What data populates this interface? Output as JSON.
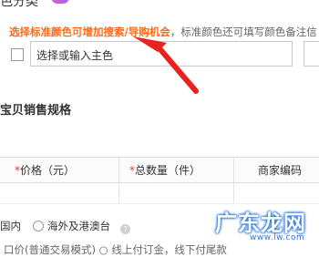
{
  "heading": {
    "partial_title": "色分类"
  },
  "hint": {
    "highlight": "选择标准颜色可增加搜索/导购机会",
    "rest": "，标准颜色还可填写颜色备注信"
  },
  "color_field": {
    "placeholder": "选择或输入主色"
  },
  "spec_section": {
    "title": "宝贝销售规格"
  },
  "table": {
    "columns": [
      {
        "required": "*",
        "label": "价格（元）"
      },
      {
        "required": "*",
        "label": "总数量（件）"
      },
      {
        "required": "",
        "label": "商家编码"
      }
    ]
  },
  "origin": {
    "option_domestic": "国内",
    "option_overseas": "海外及港澳台",
    "help": "?"
  },
  "bottom": {
    "text": "口价(普通交易模式)  ○ 线上付订金，线下付尾款"
  },
  "watermark": {
    "main": "广东龙网",
    "sub": "www.lw.com"
  },
  "colors": {
    "accent": "#ff6a1a",
    "arrow": "#e8231f",
    "required": "#e4393c",
    "watermark": "#1e6fd8"
  }
}
